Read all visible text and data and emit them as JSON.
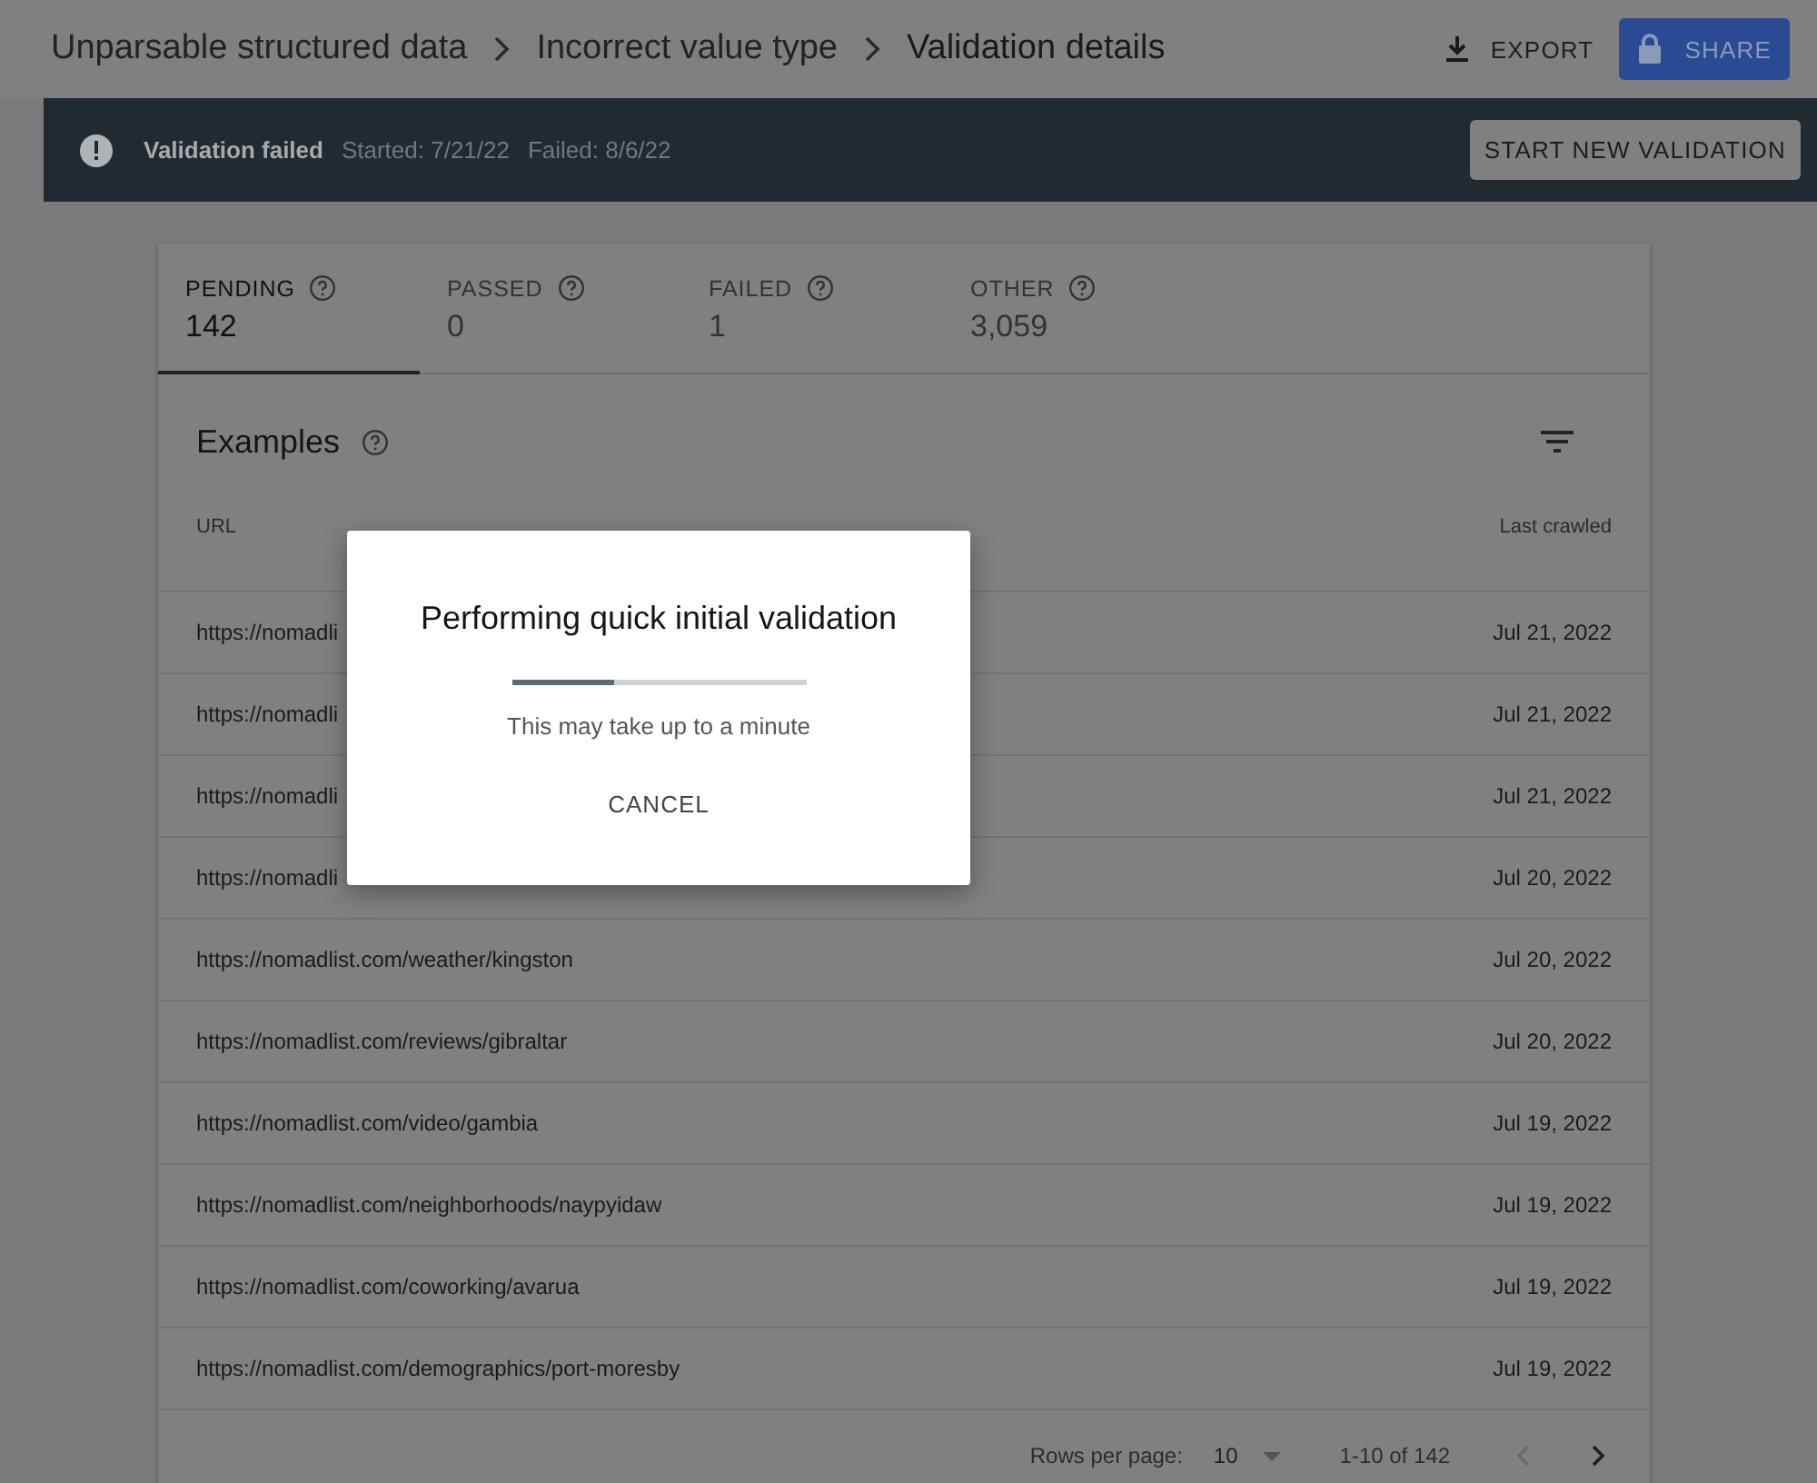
{
  "breadcrumb": [
    "Unparsable structured data",
    "Incorrect value type",
    "Validation details"
  ],
  "actions": {
    "export": "EXPORT",
    "share": "SHARE"
  },
  "banner": {
    "status": "Validation failed",
    "started": "Started: 7/21/22",
    "failed": "Failed: 8/6/22",
    "button": "START NEW VALIDATION"
  },
  "tabs": [
    {
      "label": "PENDING",
      "count": "142",
      "selected": true
    },
    {
      "label": "PASSED",
      "count": "0",
      "selected": false
    },
    {
      "label": "FAILED",
      "count": "1",
      "selected": false
    },
    {
      "label": "OTHER",
      "count": "3,059",
      "selected": false
    }
  ],
  "examples": {
    "title": "Examples",
    "columns": [
      "URL",
      "Last crawled"
    ],
    "rows": [
      {
        "url": "https://nomadli",
        "date": "Jul 21, 2022"
      },
      {
        "url": "https://nomadli",
        "date": "Jul 21, 2022"
      },
      {
        "url": "https://nomadli",
        "date": "Jul 21, 2022"
      },
      {
        "url": "https://nomadli",
        "date": "Jul 20, 2022"
      },
      {
        "url": "https://nomadlist.com/weather/kingston",
        "date": "Jul 20, 2022"
      },
      {
        "url": "https://nomadlist.com/reviews/gibraltar",
        "date": "Jul 20, 2022"
      },
      {
        "url": "https://nomadlist.com/video/gambia",
        "date": "Jul 19, 2022"
      },
      {
        "url": "https://nomadlist.com/neighborhoods/naypyidaw",
        "date": "Jul 19, 2022"
      },
      {
        "url": "https://nomadlist.com/coworking/avarua",
        "date": "Jul 19, 2022"
      },
      {
        "url": "https://nomadlist.com/demographics/port-moresby",
        "date": "Jul 19, 2022"
      }
    ]
  },
  "pagination": {
    "rows_label": "Rows per page:",
    "rows_value": "10",
    "range": "1-10 of 142"
  },
  "dialog": {
    "title": "Performing quick initial validation",
    "level": 0.35,
    "message": "This may take up to a minute",
    "button": "CANCEL"
  }
}
